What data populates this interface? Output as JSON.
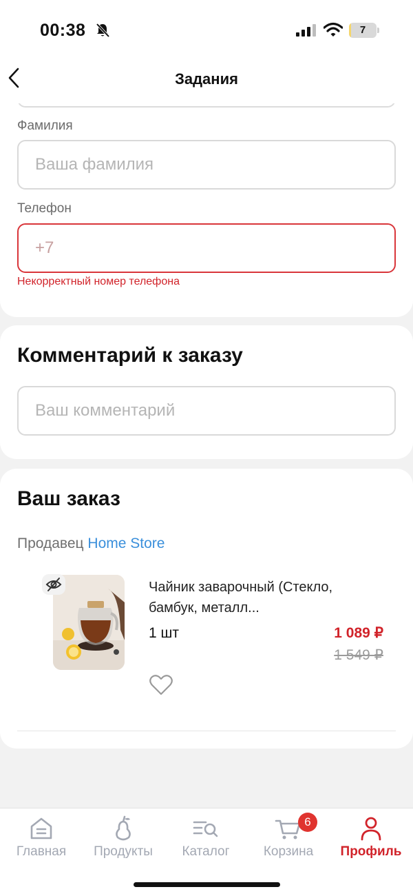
{
  "status_bar": {
    "time": "00:38",
    "battery": "7",
    "battery_level": 0.07
  },
  "nav": {
    "title": "Задания"
  },
  "form": {
    "surname_label": "Фамилия",
    "surname_placeholder": "Ваша фамилия",
    "surname_value": "",
    "phone_label": "Телефон",
    "phone_placeholder": "+7",
    "phone_value": "",
    "phone_error": "Некорректный номер телефона"
  },
  "comment": {
    "title": "Комментарий к заказу",
    "placeholder": "Ваш комментарий",
    "value": ""
  },
  "order": {
    "title": "Ваш заказ",
    "seller_prefix": "Продавец",
    "seller_name": "Home Store",
    "item": {
      "name": "Чайник заварочный (Стекло, бамбук, металл...",
      "quantity": "1 шт",
      "price": "1 089 ₽",
      "old_price": "1 549 ₽"
    }
  },
  "tabbar": {
    "items": [
      {
        "label": "Главная",
        "icon": "home-icon"
      },
      {
        "label": "Продукты",
        "icon": "pear-icon"
      },
      {
        "label": "Каталог",
        "icon": "catalog-search-icon"
      },
      {
        "label": "Корзина",
        "icon": "cart-icon"
      },
      {
        "label": "Профиль",
        "icon": "profile-icon"
      }
    ],
    "cart_badge": "6",
    "active_index": 4
  },
  "colors": {
    "accent": "#d1232a",
    "link": "#3a8fdb",
    "inactive_tab": "#a3a8b3",
    "background": "#f2f2f2"
  }
}
